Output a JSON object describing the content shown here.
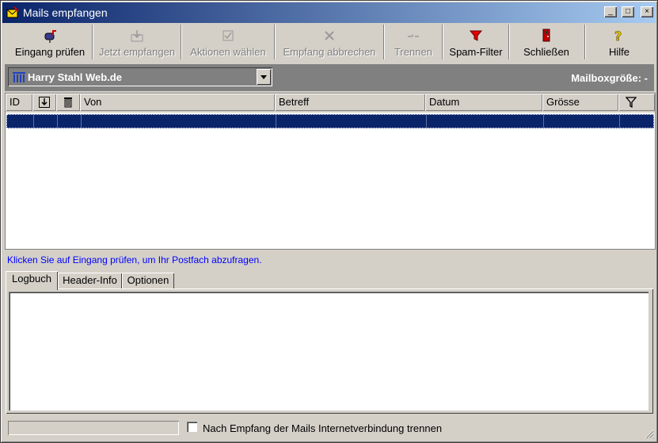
{
  "window": {
    "title": "Mails empfangen"
  },
  "titlebar_buttons": {
    "minimize": "_",
    "maximize": "□",
    "close": "×"
  },
  "toolbar": [
    {
      "label": "Eingang prüfen",
      "icon": "mailbox-icon",
      "enabled": true
    },
    {
      "label": "Jetzt empfangen",
      "icon": "download-icon",
      "enabled": false
    },
    {
      "label": "Aktionen wählen",
      "icon": "checkbox-icon",
      "enabled": false
    },
    {
      "label": "Empfang abbrechen",
      "icon": "cancel-x-icon",
      "enabled": false
    },
    {
      "label": "Trennen",
      "icon": "disconnect-icon",
      "enabled": false
    },
    {
      "label": "Spam-Filter",
      "icon": "funnel-icon",
      "enabled": true
    },
    {
      "label": "Schließen",
      "icon": "exit-door-icon",
      "enabled": true
    },
    {
      "label": "Hilfe",
      "icon": "help-icon",
      "enabled": true
    }
  ],
  "account": {
    "selected": "Harry Stahl Web.de",
    "mailbox_size_label": "Mailboxgröße: -"
  },
  "list": {
    "columns": [
      "ID",
      "",
      "",
      "Von",
      "Betreff",
      "Datum",
      "Grösse",
      ""
    ],
    "rows": []
  },
  "hint": "Klicken Sie auf Eingang prüfen, um Ihr Postfach abzufragen.",
  "tabs": [
    {
      "label": "Logbuch",
      "active": true
    },
    {
      "label": "Header-Info",
      "active": false
    },
    {
      "label": "Optionen",
      "active": false
    }
  ],
  "status": {
    "checkbox_label": "Nach Empfang der Mails Internetverbindung trennen",
    "checked": false
  },
  "colors": {
    "accent": "#0a246a",
    "hint": "#0000ff",
    "face": "#d4d0c8"
  }
}
